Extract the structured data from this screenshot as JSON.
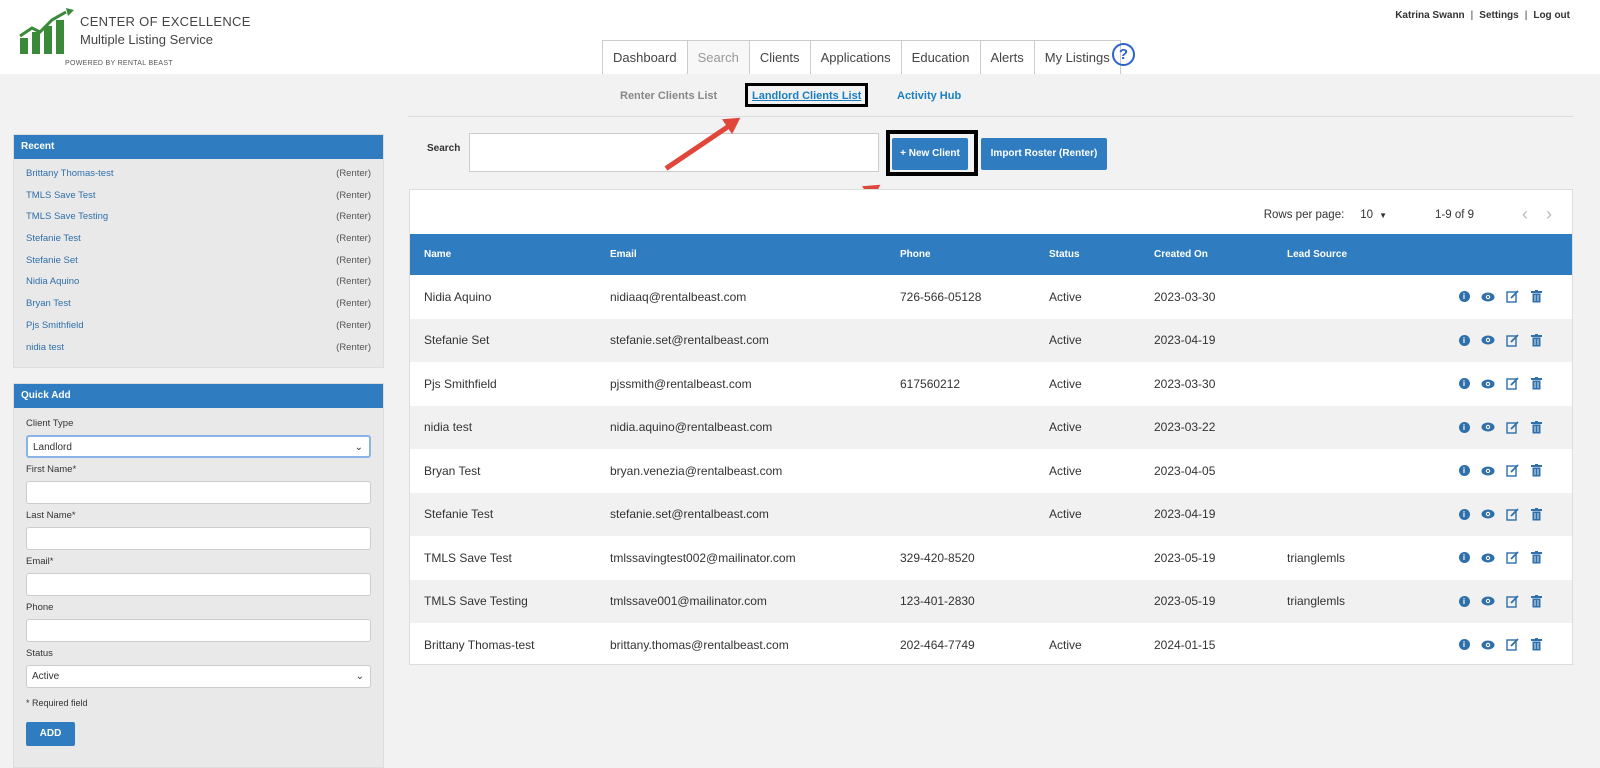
{
  "brand": {
    "line1": "CENTER OF  EXCELLENCE",
    "line2": "Multiple Listing  Service",
    "powered": "POWERED BY RENTAL BEAST"
  },
  "user_links": {
    "user": "Katrina Swann",
    "settings": "Settings",
    "logout": "Log out"
  },
  "nav": {
    "tabs": [
      "Dashboard",
      "Search",
      "Clients",
      "Applications",
      "Education",
      "Alerts",
      "My Listings"
    ],
    "help": "?"
  },
  "subnav": {
    "renter": "Renter Clients List",
    "landlord": "Landlord Clients List",
    "hub": "Activity Hub"
  },
  "recent": {
    "title": "Recent",
    "items": [
      {
        "name": "Brittany Thomas-test",
        "type": "(Renter)"
      },
      {
        "name": "TMLS Save Test",
        "type": "(Renter)"
      },
      {
        "name": "TMLS Save Testing",
        "type": "(Renter)"
      },
      {
        "name": "Stefanie Test",
        "type": "(Renter)"
      },
      {
        "name": "Stefanie Set",
        "type": "(Renter)"
      },
      {
        "name": "Nidia Aquino",
        "type": "(Renter)"
      },
      {
        "name": "Bryan Test",
        "type": "(Renter)"
      },
      {
        "name": "Pjs Smithfield",
        "type": "(Renter)"
      },
      {
        "name": "nidia test",
        "type": "(Renter)"
      }
    ]
  },
  "quick_add": {
    "title": "Quick Add",
    "client_type_label": "Client Type",
    "client_type_value": "Landlord",
    "first_name_label": "First Name*",
    "last_name_label": "Last Name*",
    "email_label": "Email*",
    "phone_label": "Phone",
    "status_label": "Status",
    "status_value": "Active",
    "required_note": "* Required field",
    "add_label": "ADD"
  },
  "search": {
    "label": "Search",
    "new_client": "+ New Client",
    "import": "Import Roster (Renter)"
  },
  "pager": {
    "rows_per_page_label": "Rows per page:",
    "rows_per_page": "10",
    "range": "1-9 of 9"
  },
  "table": {
    "headers": {
      "name": "Name",
      "email": "Email",
      "phone": "Phone",
      "status": "Status",
      "created": "Created On",
      "lead": "Lead Source"
    },
    "rows": [
      {
        "name": "Nidia Aquino",
        "email": "nidiaaq@rentalbeast.com",
        "phone": "726-566-05128",
        "status": "Active",
        "created": "2023-03-30",
        "lead": ""
      },
      {
        "name": "Stefanie Set",
        "email": "stefanie.set@rentalbeast.com",
        "phone": "",
        "status": "Active",
        "created": "2023-04-19",
        "lead": ""
      },
      {
        "name": "Pjs Smithfield",
        "email": "pjssmith@rentalbeast.com",
        "phone": "617560212",
        "status": "Active",
        "created": "2023-03-30",
        "lead": ""
      },
      {
        "name": "nidia test",
        "email": "nidia.aquino@rentalbeast.com",
        "phone": "",
        "status": "Active",
        "created": "2023-03-22",
        "lead": ""
      },
      {
        "name": "Bryan Test",
        "email": "bryan.venezia@rentalbeast.com",
        "phone": "",
        "status": "Active",
        "created": "2023-04-05",
        "lead": ""
      },
      {
        "name": "Stefanie Test",
        "email": "stefanie.set@rentalbeast.com",
        "phone": "",
        "status": "Active",
        "created": "2023-04-19",
        "lead": ""
      },
      {
        "name": "TMLS Save Test",
        "email": "tmlssavingtest002@mailinator.com",
        "phone": "329-420-8520",
        "status": "",
        "created": "2023-05-19",
        "lead": "trianglemls"
      },
      {
        "name": "TMLS Save Testing",
        "email": "tmlssave001@mailinator.com",
        "phone": "123-401-2830",
        "status": "",
        "created": "2023-05-19",
        "lead": "trianglemls"
      },
      {
        "name": "Brittany Thomas-test",
        "email": "brittany.thomas@rentalbeast.com",
        "phone": "202-464-7749",
        "status": "Active",
        "created": "2024-01-15",
        "lead": ""
      }
    ]
  },
  "colors": {
    "primary": "#2f7dc0",
    "link": "#1a7fc1",
    "arrow": "#e0463a",
    "logo_green": "#3a8a3a"
  }
}
